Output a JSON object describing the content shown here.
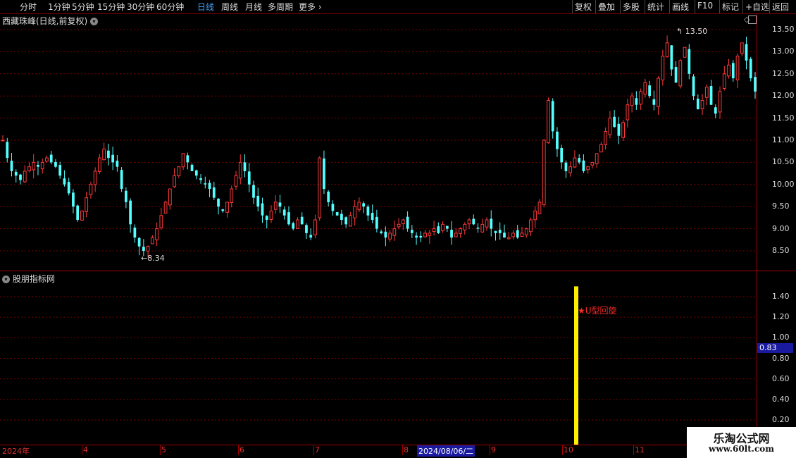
{
  "toolbar": {
    "periods": [
      "分时",
      "1分钟",
      "5分钟",
      "15分钟",
      "30分钟",
      "60分钟",
      "日线",
      "周线",
      "月线",
      "多周期",
      "更多"
    ],
    "active_period": "日线",
    "right_buttons": [
      "复权",
      "叠加",
      "多股",
      "统计",
      "画线",
      "F10",
      "标记",
      "+自选",
      "返回"
    ]
  },
  "main_chart": {
    "title": "西藏珠峰(日线,前复权)",
    "y_ticks": [
      "13.50",
      "13.00",
      "12.50",
      "12.00",
      "11.50",
      "11.00",
      "10.50",
      "10.00",
      "9.50",
      "9.00",
      "8.50"
    ],
    "max_label": "13.50",
    "min_label": "8.34",
    "colors": {
      "up": "#ff3a3a",
      "down": "#54ffff"
    }
  },
  "sub_chart": {
    "title": "股朋指标网",
    "y_ticks": [
      "1.40",
      "1.20",
      "1.00",
      "0.80",
      "0.60",
      "0.40",
      "0.20"
    ],
    "current_value": "0.83",
    "signal_label": "U型回旋",
    "signal_color": "#ffee00"
  },
  "x_axis": {
    "labels": [
      "2024年",
      "4",
      "5",
      "6",
      "7",
      "8",
      "9",
      "10",
      "11"
    ],
    "cursor_date": "2024/08/06/二"
  },
  "watermark": {
    "line1": "乐淘公式网",
    "line2": "www.60lt.com"
  },
  "chart_data": {
    "type": "candlestick",
    "price_range": [
      8.34,
      13.5
    ],
    "series_close": [
      11.0,
      10.6,
      10.3,
      10.2,
      10.1,
      10.3,
      10.4,
      10.5,
      10.4,
      10.5,
      10.6,
      10.5,
      10.4,
      10.2,
      10.0,
      9.8,
      9.5,
      9.2,
      9.4,
      9.7,
      10.0,
      10.3,
      10.6,
      10.8,
      10.6,
      10.5,
      10.4,
      9.9,
      9.6,
      9.1,
      8.8,
      8.6,
      8.5,
      8.6,
      8.8,
      9.0,
      9.3,
      9.6,
      9.9,
      10.2,
      10.4,
      10.7,
      10.5,
      10.3,
      10.2,
      10.1,
      10.0,
      9.9,
      9.7,
      9.5,
      9.4,
      9.6,
      9.9,
      10.2,
      10.5,
      10.3,
      10.0,
      9.7,
      9.5,
      9.3,
      9.2,
      9.4,
      9.6,
      9.5,
      9.3,
      9.1,
      9.0,
      9.2,
      9.1,
      8.9,
      8.8,
      9.2,
      10.6,
      9.9,
      9.6,
      9.4,
      9.3,
      9.2,
      9.1,
      9.3,
      9.5,
      9.6,
      9.5,
      9.3,
      9.2,
      9.0,
      8.9,
      8.8,
      8.9,
      9.0,
      9.1,
      9.2,
      9.0,
      8.9,
      8.8,
      8.8,
      8.9,
      8.9,
      9.0,
      8.9,
      9.1,
      9.0,
      8.8,
      8.9,
      9.0,
      9.1,
      9.2,
      9.1,
      9.0,
      9.1,
      9.2,
      9.0,
      8.9,
      8.9,
      8.8,
      8.8,
      8.9,
      8.8,
      8.9,
      9.0,
      9.2,
      9.4,
      9.6,
      11.0,
      11.9,
      11.2,
      10.8,
      10.5,
      10.3,
      10.4,
      10.6,
      10.5,
      10.3,
      10.4,
      10.5,
      10.7,
      10.9,
      11.2,
      11.5,
      11.3,
      11.1,
      11.4,
      11.8,
      12.0,
      11.8,
      12.1,
      12.3,
      12.0,
      11.8,
      12.4,
      12.9,
      13.2,
      12.6,
      12.3,
      12.8,
      13.1,
      12.5,
      12.0,
      11.7,
      11.9,
      12.2,
      11.8,
      11.6,
      12.1,
      12.5,
      12.7,
      12.4,
      12.9,
      13.2,
      12.8,
      12.4,
      12.1
    ]
  }
}
